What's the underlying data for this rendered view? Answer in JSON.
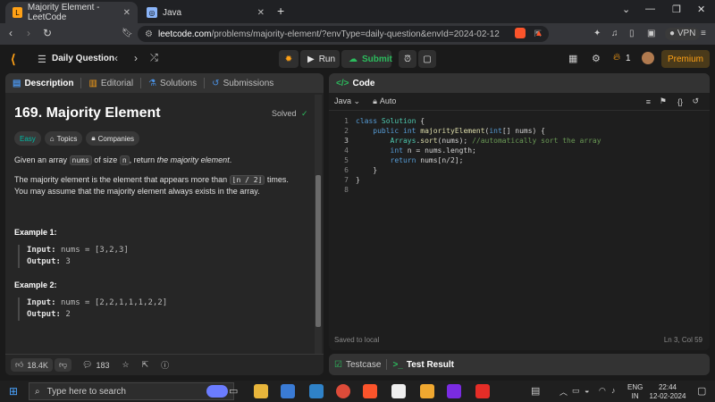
{
  "browser": {
    "tabs": [
      {
        "title": "Majority Element - LeetCode",
        "active": true
      },
      {
        "title": "Java",
        "active": false
      }
    ],
    "new_tab": "+",
    "url_host": "leetcode.com",
    "url_path": "/problems/majority-element/?envType=daily-question&envId=2024-02-12",
    "vpn_label": "VPN"
  },
  "lc_header": {
    "daily_question": "Daily Question",
    "run": "Run",
    "submit": "Submit",
    "streak": "1",
    "premium": "Premium"
  },
  "description_panel": {
    "tabs": [
      "Description",
      "Editorial",
      "Solutions",
      "Submissions"
    ],
    "title": "169. Majority Element",
    "status": "Solved",
    "tags": [
      "Easy",
      "Topics",
      "Companies"
    ],
    "para1_a": "Given an array ",
    "para1_code": "nums",
    "para1_b": " of size ",
    "para1_code2": "n",
    "para1_c": ", return ",
    "para1_em": "the majority element",
    "para1_d": ".",
    "para2_a": "The majority element is the element that appears more than ",
    "para2_code": "⌊n / 2⌋",
    "para2_b": " times. You may assume that the majority element always exists in the array.",
    "example1_title": "Example 1:",
    "example1_input_label": "Input:",
    "example1_input": "nums = [3,2,3]",
    "example1_output_label": "Output:",
    "example1_output": "3",
    "example2_title": "Example 2:",
    "example2_input_label": "Input:",
    "example2_input": "nums = [2,2,1,1,1,2,2]",
    "example2_output_label": "Output:",
    "example2_output": "2",
    "likes": "18.4K",
    "comments": "183"
  },
  "code_panel": {
    "tab": "Code",
    "language": "Java",
    "mode": "Auto",
    "status_left": "Saved to local",
    "status_right": "Ln 3, Col 59",
    "line_numbers": [
      "1",
      "2",
      "3",
      "4",
      "5",
      "6",
      "7",
      "8"
    ]
  },
  "bottom_panel": {
    "testcase": "Testcase",
    "test_result": "Test Result"
  },
  "taskbar": {
    "search_placeholder": "Type here to search",
    "lang1": "ENG",
    "lang2": "IN",
    "time": "22:44",
    "date": "12-02-2024"
  },
  "colors": {
    "accent_orange": "#ffa116",
    "easy_green": "#00b8a3",
    "submit_green": "#2cbb5d",
    "solved_green": "#2cbb5d"
  }
}
